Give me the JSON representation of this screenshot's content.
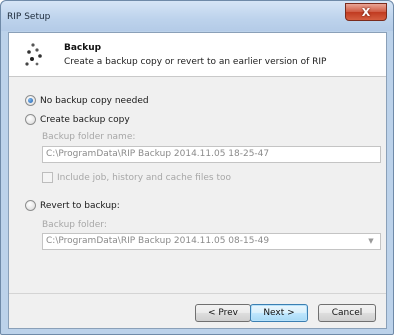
{
  "window": {
    "title": "RIP Setup",
    "close_glyph": "X"
  },
  "header": {
    "title": "Backup",
    "subtitle": "Create a backup copy or revert to an earlier version of RIP",
    "icon": "dots-logo-icon"
  },
  "options": {
    "no_backup": {
      "label": "No backup copy needed",
      "selected": true
    },
    "create_backup": {
      "label": "Create backup copy",
      "selected": false,
      "folder_label": "Backup folder name:",
      "folder_value": "C:\\ProgramData\\RIP Backup 2014.11.05 18-25-47",
      "include_label": "Include job, history and cache files too",
      "include_checked": false
    },
    "revert": {
      "label": "Revert to backup:",
      "selected": false,
      "folder_label": "Backup folder:",
      "folder_value": "C:\\ProgramData\\RIP Backup 2014.11.05 08-15-49"
    }
  },
  "buttons": {
    "prev": "< Prev",
    "next": "Next >",
    "cancel": "Cancel"
  },
  "colors": {
    "accent": "#1b5fb0",
    "disabled_text": "#a7a7a7",
    "close": "#c03a20"
  }
}
